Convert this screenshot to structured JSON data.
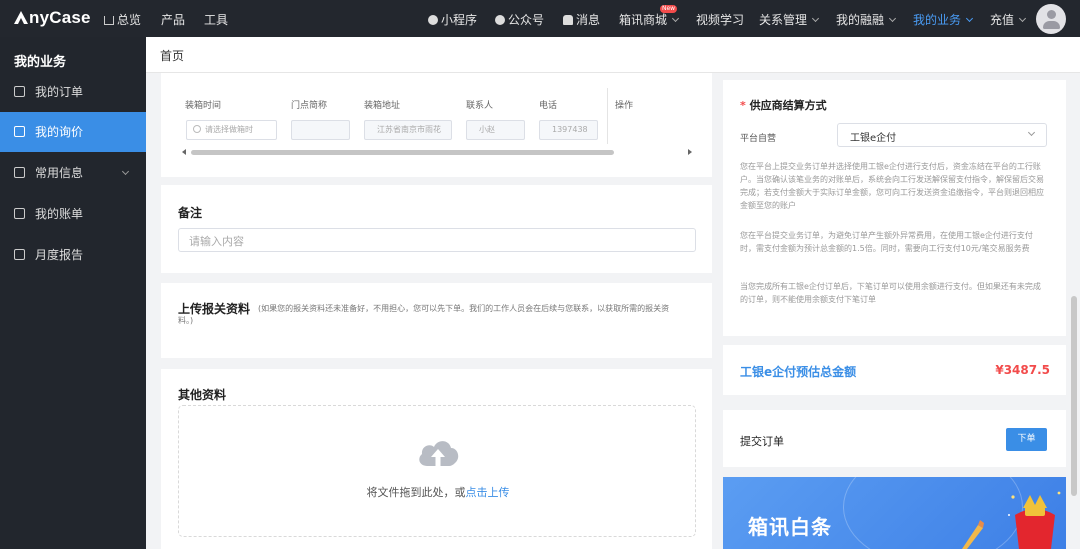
{
  "header": {
    "logo": "nyCase",
    "home": "总览",
    "left_items": [
      "产品",
      "工具"
    ],
    "right_items": {
      "mini_program": "小程序",
      "official_account": "公众号",
      "messages": "消息",
      "store": "箱讯商城",
      "store_badge": "New",
      "video": "视频学习",
      "relations": "关系管理",
      "finance": "我的融融",
      "business": "我的业务",
      "recharge": "充值"
    }
  },
  "sidebar": {
    "title": "我的业务",
    "items": [
      {
        "label": "我的订单"
      },
      {
        "label": "我的询价"
      },
      {
        "label": "常用信息"
      },
      {
        "label": "我的账单"
      },
      {
        "label": "月度报告"
      }
    ]
  },
  "breadcrumb": "首页",
  "table": {
    "headers": [
      "装箱时间",
      "门点简称",
      "装箱地址",
      "联系人",
      "电话",
      "操作"
    ],
    "row": {
      "time_placeholder": "请选择做箱时",
      "short_name": "",
      "address": "江苏省南京市雨花",
      "contact": "小赵",
      "phone": "1397438"
    }
  },
  "remarks": {
    "title": "备注",
    "placeholder": "请输入内容"
  },
  "customs": {
    "title": "上传报关资料",
    "note": "(如果您的报关资料还未准备好，不用担心，您可以先下单。我们的工作人员会在后续与您联系，以获取所需的报关资料。)"
  },
  "other": {
    "title": "其他资料",
    "drag_text": "将文件拖到此处，或",
    "click_upload": "点击上传"
  },
  "settlement": {
    "required_mark": "*",
    "title": "供应商结算方式",
    "platform_label": "平台自营",
    "selected_method": "工银e企付",
    "paragraphs": [
      "您在平台上提交业务订单并选择使用工银e企付进行支付后，资金冻结在平台的工行账户。当您确认该笔业务的对账单后，系统会向工行发送解保留支付指令，解保留后交易完成；若支付金额大于实际订单金额，您可向工行发送资金追缴指令，平台则退回相应金额至您的账户",
      "您在平台提交业务订单，为避免订单产生额外异常费用，在使用工银e企付进行支付时，需支付金额为预计总金额的1.5倍。同时，需要向工行支付10元/笔交易服务费",
      "当您完成所有工银e企付订单后，下笔订单可以使用余额进行支付。但如果还有未完成的订单，则不能使用余额支付下笔订单"
    ]
  },
  "total": {
    "label": "工银e企付预估总金额",
    "value": "¥3487.5"
  },
  "submit": {
    "label": "提交订单",
    "button": "下单"
  },
  "banner": {
    "title": "箱讯白条"
  },
  "colors": {
    "accent": "#3a8ee6",
    "price": "#f24b4b",
    "sidebar_bg": "#22262d",
    "header_bg": "#23272e"
  }
}
